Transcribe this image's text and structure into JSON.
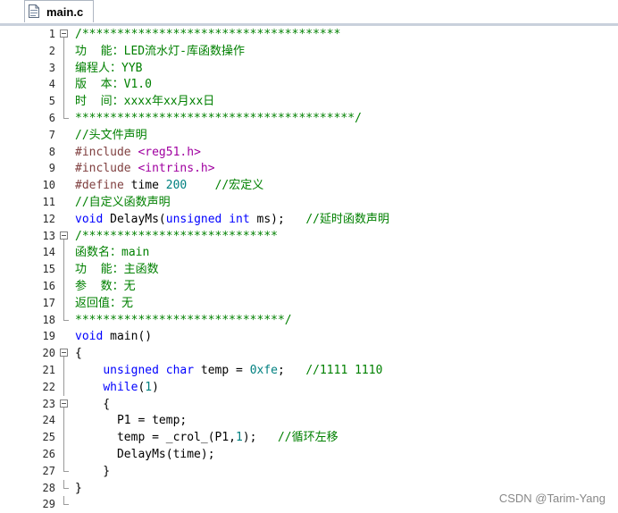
{
  "tab": {
    "filename": "main.c",
    "icon": "c-file-icon"
  },
  "colors": {
    "comment": "#008000",
    "keyword": "#0000ff",
    "preprocessor": "#804040",
    "string": "#a000a0",
    "number": "#008080",
    "text": "#000000"
  },
  "lines": [
    {
      "n": "1",
      "fold": "open",
      "tokens": [
        [
          "c",
          "/*************************************"
        ]
      ]
    },
    {
      "n": "2",
      "fold": "bar",
      "tokens": [
        [
          "c",
          "功  能：LED流水灯-库函数操作"
        ]
      ]
    },
    {
      "n": "3",
      "fold": "bar",
      "tokens": [
        [
          "c",
          "编程人：YYB"
        ]
      ]
    },
    {
      "n": "4",
      "fold": "bar",
      "tokens": [
        [
          "c",
          "版  本：V1.0"
        ]
      ]
    },
    {
      "n": "5",
      "fold": "bar",
      "tokens": [
        [
          "c",
          "时  间：xxxx年xx月xx日"
        ]
      ]
    },
    {
      "n": "6",
      "fold": "end",
      "tokens": [
        [
          "c",
          "****************************************/"
        ]
      ]
    },
    {
      "n": "7",
      "fold": "",
      "tokens": [
        [
          "c",
          "//头文件声明"
        ]
      ]
    },
    {
      "n": "8",
      "fold": "",
      "tokens": [
        [
          "p",
          "#include "
        ],
        [
          "s",
          "<reg51.h>"
        ]
      ]
    },
    {
      "n": "9",
      "fold": "",
      "tokens": [
        [
          "p",
          "#include "
        ],
        [
          "s",
          "<intrins.h>"
        ]
      ]
    },
    {
      "n": "10",
      "fold": "",
      "tokens": [
        [
          "p",
          "#define "
        ],
        [
          "t",
          "time "
        ],
        [
          "n",
          "200"
        ],
        [
          "t",
          "    "
        ],
        [
          "c",
          "//宏定义"
        ]
      ]
    },
    {
      "n": "11",
      "fold": "",
      "tokens": [
        [
          "c",
          "//自定义函数声明"
        ]
      ]
    },
    {
      "n": "12",
      "fold": "",
      "tokens": [
        [
          "k",
          "void"
        ],
        [
          "t",
          " DelayMs("
        ],
        [
          "k",
          "unsigned int"
        ],
        [
          "t",
          " ms);   "
        ],
        [
          "c",
          "//延时函数声明"
        ]
      ]
    },
    {
      "n": "13",
      "fold": "open",
      "tokens": [
        [
          "c",
          "/****************************"
        ]
      ]
    },
    {
      "n": "14",
      "fold": "bar",
      "tokens": [
        [
          "c",
          "函数名：main"
        ]
      ]
    },
    {
      "n": "15",
      "fold": "bar",
      "tokens": [
        [
          "c",
          "功  能：主函数"
        ]
      ]
    },
    {
      "n": "16",
      "fold": "bar",
      "tokens": [
        [
          "c",
          "参  数：无"
        ]
      ]
    },
    {
      "n": "17",
      "fold": "bar",
      "tokens": [
        [
          "c",
          "返回值：无"
        ]
      ]
    },
    {
      "n": "18",
      "fold": "end",
      "tokens": [
        [
          "c",
          "******************************/"
        ]
      ]
    },
    {
      "n": "19",
      "fold": "",
      "tokens": [
        [
          "k",
          "void"
        ],
        [
          "t",
          " main()"
        ]
      ]
    },
    {
      "n": "20",
      "fold": "open",
      "tokens": [
        [
          "t",
          "{"
        ]
      ]
    },
    {
      "n": "21",
      "fold": "bar",
      "tokens": [
        [
          "t",
          "    "
        ],
        [
          "k",
          "unsigned char"
        ],
        [
          "t",
          " temp = "
        ],
        [
          "n",
          "0xfe"
        ],
        [
          "t",
          ";   "
        ],
        [
          "c",
          "//1111 1110"
        ]
      ]
    },
    {
      "n": "22",
      "fold": "bar",
      "tokens": [
        [
          "t",
          "    "
        ],
        [
          "k",
          "while"
        ],
        [
          "t",
          "("
        ],
        [
          "n",
          "1"
        ],
        [
          "t",
          ")"
        ]
      ]
    },
    {
      "n": "23",
      "fold": "open",
      "tokens": [
        [
          "t",
          "    {"
        ]
      ]
    },
    {
      "n": "24",
      "fold": "bar",
      "tokens": [
        [
          "t",
          "      P1 = temp;"
        ]
      ]
    },
    {
      "n": "25",
      "fold": "bar",
      "tokens": [
        [
          "t",
          "      temp = _crol_(P1,"
        ],
        [
          "n",
          "1"
        ],
        [
          "t",
          ");   "
        ],
        [
          "c",
          "//循环左移"
        ]
      ]
    },
    {
      "n": "26",
      "fold": "bar",
      "tokens": [
        [
          "t",
          "      DelayMs(time);"
        ]
      ]
    },
    {
      "n": "27",
      "fold": "end",
      "tokens": [
        [
          "t",
          "    }"
        ]
      ]
    },
    {
      "n": "28",
      "fold": "end",
      "tokens": [
        [
          "t",
          "}"
        ]
      ]
    },
    {
      "n": "29",
      "fold": "end",
      "tokens": []
    }
  ],
  "watermark": "CSDN @Tarim-Yang"
}
